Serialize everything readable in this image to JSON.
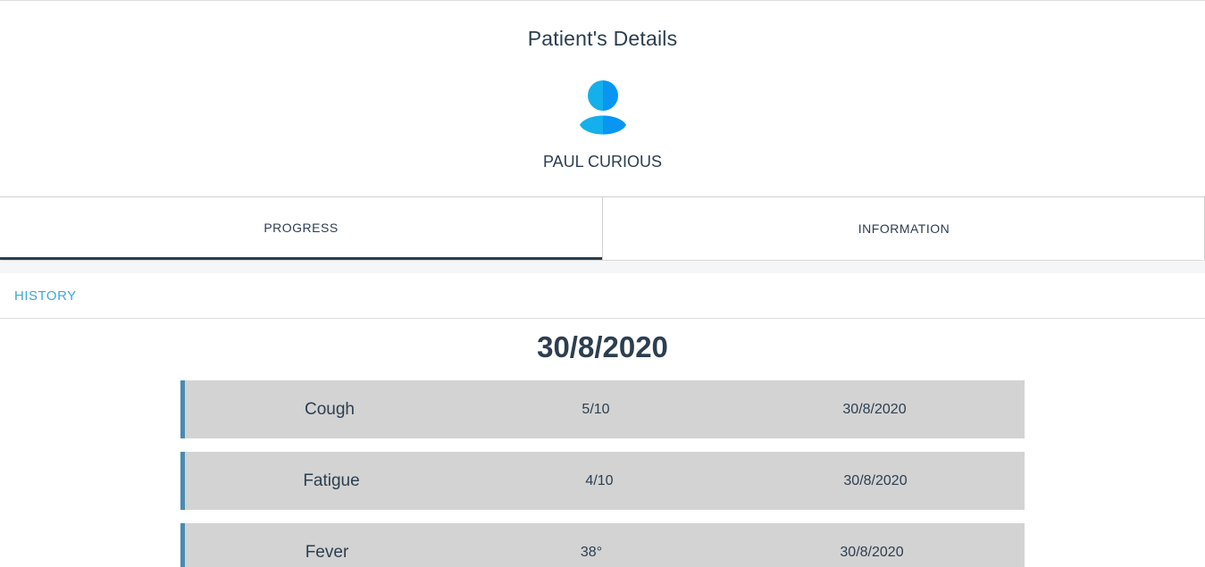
{
  "header": {
    "title": "Patient's Details",
    "avatar_icon": "user-avatar-icon",
    "patient_name": "PAUL CURIOUS"
  },
  "tabs": [
    {
      "label": "PROGRESS",
      "active": true
    },
    {
      "label": "INFORMATION",
      "active": false
    }
  ],
  "history": {
    "label": "HISTORY",
    "date": "30/8/2020",
    "entries": [
      {
        "symptom": "Cough",
        "level": "5/10",
        "date": "30/8/2020"
      },
      {
        "symptom": "Fatigue",
        "level": "4/10",
        "date": "30/8/2020"
      },
      {
        "symptom": "Fever",
        "level": "38°",
        "date": "30/8/2020"
      }
    ]
  },
  "colors": {
    "text": "#2c3e50",
    "accent": "#3ea7d8",
    "row_bg": "#d3d3d3",
    "row_border": "#4a8bb0",
    "avatar": "#0aa4f0"
  }
}
